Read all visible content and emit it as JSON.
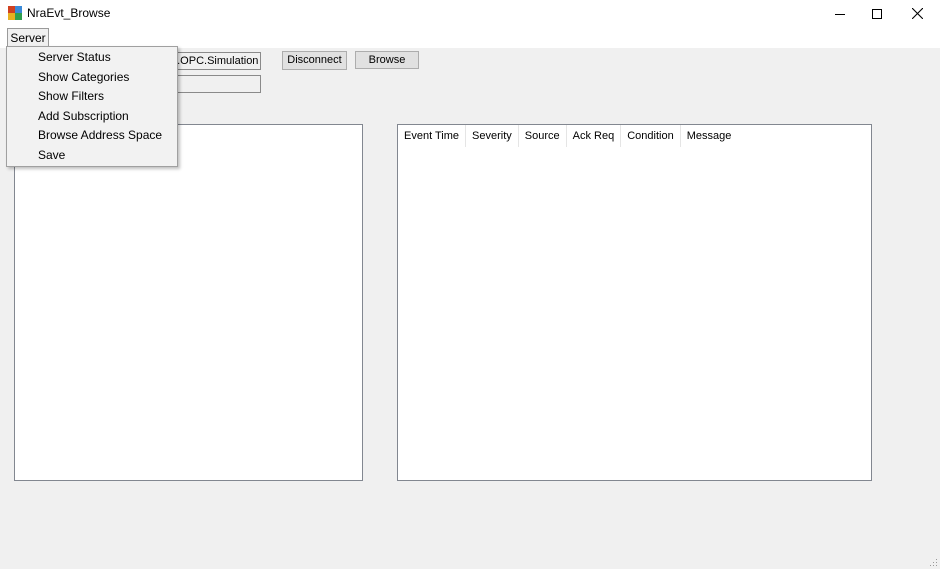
{
  "window": {
    "title": "NraEvt_Browse",
    "controls": {
      "minimize": "minimize-icon",
      "maximize": "maximize-icon",
      "close": "close-icon"
    }
  },
  "menubar": {
    "server_label": "Server",
    "server_menu_items": [
      "Server Status",
      "Show Categories",
      "Show Filters",
      "Add Subscription",
      "Browse Address Space",
      "Save"
    ]
  },
  "toolbar": {
    "server_field_value": "n.OPC.Simulation",
    "second_field_value": "",
    "disconnect_label": "Disconnect",
    "browse_label": "Browse"
  },
  "event_list": {
    "columns": [
      "Event Time",
      "Severity",
      "Source",
      "Ack Req",
      "Condition",
      "Message"
    ]
  }
}
